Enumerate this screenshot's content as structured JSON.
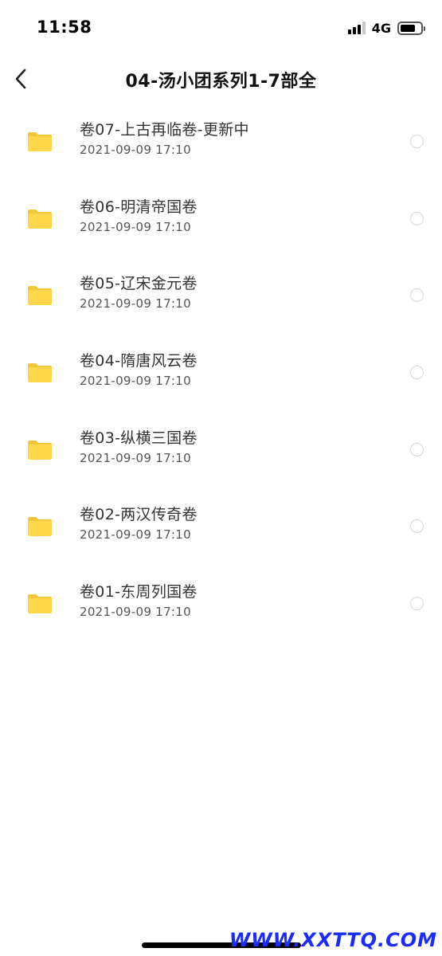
{
  "status_bar": {
    "time": "11:58",
    "network": "4G",
    "battery_level": 0.75
  },
  "header": {
    "title": "04-汤小团系列1-7部全"
  },
  "files": [
    {
      "name": "卷07-上古再临卷-更新中",
      "date": "2021-09-09 17:10"
    },
    {
      "name": "卷06-明清帝国卷",
      "date": "2021-09-09 17:10"
    },
    {
      "name": "卷05-辽宋金元卷",
      "date": "2021-09-09 17:10"
    },
    {
      "name": "卷04-隋唐风云卷",
      "date": "2021-09-09 17:10"
    },
    {
      "name": "卷03-纵横三国卷",
      "date": "2021-09-09 17:10"
    },
    {
      "name": "卷02-两汉传奇卷",
      "date": "2021-09-09 17:10"
    },
    {
      "name": "卷01-东周列国卷",
      "date": "2021-09-09 17:10"
    }
  ],
  "watermark": "WWW.XXTTQ.COM",
  "colors": {
    "folder": "#FFD54A",
    "folder_tab": "#F6C63A",
    "watermark": "#1A2BFF"
  }
}
